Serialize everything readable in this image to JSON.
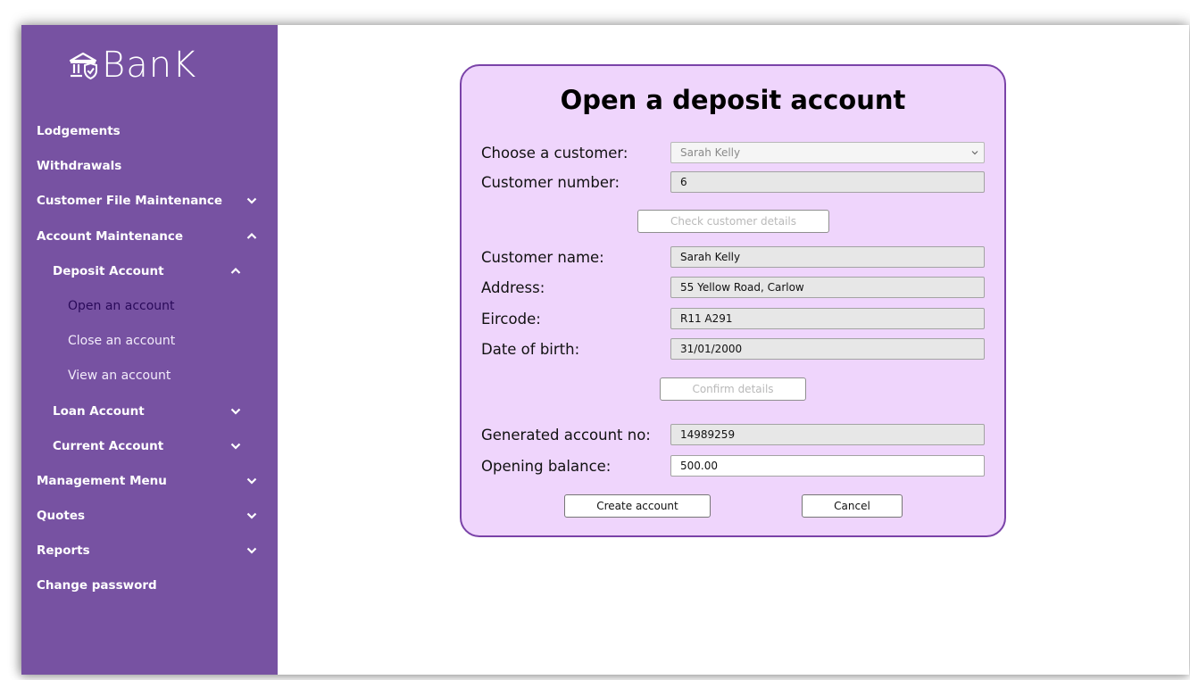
{
  "brand": {
    "name": "BanK",
    "icon": "bank-shield-icon"
  },
  "sidebar": {
    "items": [
      {
        "label": "Lodgements",
        "level": 1,
        "chevron": ""
      },
      {
        "label": "Withdrawals",
        "level": 1,
        "chevron": ""
      },
      {
        "label": "Customer File Maintenance",
        "level": 1,
        "chevron": "down"
      },
      {
        "label": "Account Maintenance",
        "level": 1,
        "chevron": "up"
      },
      {
        "label": "Deposit Account",
        "level": 2,
        "chevron": "up"
      },
      {
        "label": "Open an account",
        "level": 3,
        "chevron": "",
        "active": true
      },
      {
        "label": "Close an account",
        "level": 3,
        "chevron": ""
      },
      {
        "label": "View an account",
        "level": 3,
        "chevron": ""
      },
      {
        "label": "Loan Account",
        "level": 2,
        "chevron": "down"
      },
      {
        "label": "Current Account",
        "level": 2,
        "chevron": "down"
      },
      {
        "label": "Management Menu",
        "level": 1,
        "chevron": "down"
      },
      {
        "label": "Quotes",
        "level": 1,
        "chevron": "down"
      },
      {
        "label": "Reports",
        "level": 1,
        "chevron": "down"
      },
      {
        "label": "Change password",
        "level": 1,
        "chevron": ""
      }
    ]
  },
  "form": {
    "title": "Open a deposit account",
    "choose_customer": {
      "label": "Choose a customer:",
      "value": "Sarah Kelly"
    },
    "customer_number": {
      "label": "Customer number:",
      "value": "6"
    },
    "check_button": "Check customer details",
    "customer_name": {
      "label": "Customer name:",
      "value": "Sarah Kelly"
    },
    "address": {
      "label": "Address:",
      "value": "55 Yellow Road, Carlow"
    },
    "eircode": {
      "label": "Eircode:",
      "value": "R11 A291"
    },
    "dob": {
      "label": "Date of birth:",
      "value": "31/01/2000"
    },
    "confirm_button": "Confirm details",
    "account_no": {
      "label": "Generated account no:",
      "value": "14989259"
    },
    "opening_balance": {
      "label": "Opening balance:",
      "value": "500.00"
    },
    "create_button": "Create account",
    "cancel_button": "Cancel"
  },
  "colors": {
    "sidebar_bg": "#7752a2",
    "card_bg": "#efd5fc",
    "card_border": "#7a43a8",
    "active_link": "#2a0a5a"
  }
}
